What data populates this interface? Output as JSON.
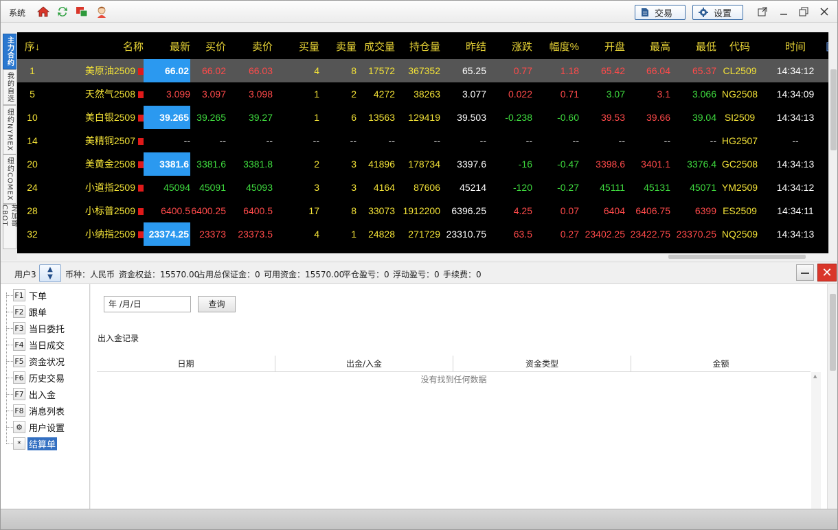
{
  "titlebar": {
    "menu_label": "系统",
    "trade_label": "交易",
    "settings_label": "设置"
  },
  "vtabs": [
    "主力合约",
    "我的自选",
    "纽约NYMEX",
    "纽约COMEX",
    "芝加哥CBOT"
  ],
  "quote": {
    "headers": [
      "序↓",
      "名称",
      "最新",
      "买价",
      "卖价",
      "买量",
      "卖量",
      "成交量",
      "持仓量",
      "昨结",
      "涨跌",
      "幅度%",
      "开盘",
      "最高",
      "最低",
      "代码",
      "时间"
    ],
    "rows": [
      {
        "seq": "1",
        "name": "美原油2509",
        "last": "66.02",
        "bid": "66.02",
        "ask": "66.03",
        "bidvol": "4",
        "askvol": "8",
        "vol": "17572",
        "oi": "367352",
        "prev": "65.25",
        "chg": "0.77",
        "pct": "1.18",
        "open": "65.42",
        "high": "66.04",
        "low": "65.37",
        "code": "CL2509",
        "time": "14:34:12"
      },
      {
        "seq": "5",
        "name": "天然气2508",
        "last": "3.099",
        "bid": "3.097",
        "ask": "3.098",
        "bidvol": "1",
        "askvol": "2",
        "vol": "4272",
        "oi": "38263",
        "prev": "3.077",
        "chg": "0.022",
        "pct": "0.71",
        "open": "3.07",
        "high": "3.1",
        "low": "3.066",
        "code": "NG2508",
        "time": "14:34:09"
      },
      {
        "seq": "10",
        "name": "美白银2509",
        "last": "39.265",
        "bid": "39.265",
        "ask": "39.27",
        "bidvol": "1",
        "askvol": "6",
        "vol": "13563",
        "oi": "129419",
        "prev": "39.503",
        "chg": "-0.238",
        "pct": "-0.60",
        "open": "39.53",
        "high": "39.66",
        "low": "39.04",
        "code": "SI2509",
        "time": "14:34:13"
      },
      {
        "seq": "14",
        "name": "美精铜2507",
        "last": "--",
        "bid": "--",
        "ask": "--",
        "bidvol": "--",
        "askvol": "--",
        "vol": "--",
        "oi": "--",
        "prev": "--",
        "chg": "--",
        "pct": "--",
        "open": "--",
        "high": "--",
        "low": "--",
        "code": "HG2507",
        "time": "--"
      },
      {
        "seq": "20",
        "name": "美黄金2508",
        "last": "3381.6",
        "bid": "3381.6",
        "ask": "3381.8",
        "bidvol": "2",
        "askvol": "3",
        "vol": "41896",
        "oi": "178734",
        "prev": "3397.6",
        "chg": "-16",
        "pct": "-0.47",
        "open": "3398.6",
        "high": "3401.1",
        "low": "3376.4",
        "code": "GC2508",
        "time": "14:34:13"
      },
      {
        "seq": "24",
        "name": "小道指2509",
        "last": "45094",
        "bid": "45091",
        "ask": "45093",
        "bidvol": "3",
        "askvol": "3",
        "vol": "4164",
        "oi": "87606",
        "prev": "45214",
        "chg": "-120",
        "pct": "-0.27",
        "open": "45111",
        "high": "45131",
        "low": "45071",
        "code": "YM2509",
        "time": "14:34:12"
      },
      {
        "seq": "28",
        "name": "小标普2509",
        "last": "6400.5",
        "bid": "6400.25",
        "ask": "6400.5",
        "bidvol": "17",
        "askvol": "8",
        "vol": "33073",
        "oi": "1912200",
        "prev": "6396.25",
        "chg": "4.25",
        "pct": "0.07",
        "open": "6404",
        "high": "6406.75",
        "low": "6399",
        "code": "ES2509",
        "time": "14:34:11"
      },
      {
        "seq": "32",
        "name": "小纳指2509",
        "last": "23374.25",
        "bid": "23373",
        "ask": "23373.5",
        "bidvol": "4",
        "askvol": "1",
        "vol": "24828",
        "oi": "271729",
        "prev": "23310.75",
        "chg": "63.5",
        "pct": "0.27",
        "open": "23402.25",
        "high": "23422.75",
        "low": "23370.25",
        "code": "NQ2509",
        "time": "14:34:13"
      }
    ]
  },
  "account": {
    "user": "用户3",
    "currency": "币种：人民币",
    "equity": "资金权益：15570.00",
    "margin": "占用总保证金：0",
    "available": "可用资金：15570.00",
    "close_pl": "平仓盈亏：0",
    "float_pl": "浮动盈亏：0",
    "fee": "手续费：0"
  },
  "tree": [
    {
      "key": "F1",
      "label": "下单"
    },
    {
      "key": "F2",
      "label": "跟单"
    },
    {
      "key": "F3",
      "label": "当日委托"
    },
    {
      "key": "F4",
      "label": "当日成交"
    },
    {
      "key": "F5",
      "label": "资金状况"
    },
    {
      "key": "F6",
      "label": "历史交易"
    },
    {
      "key": "F7",
      "label": "出入金"
    },
    {
      "key": "F8",
      "label": "消息列表"
    },
    {
      "key": "⚙",
      "label": "用户设置"
    },
    {
      "key": "*",
      "label": "结算单"
    }
  ],
  "content": {
    "date_value": "年 /月/日",
    "query_label": "查询",
    "section_title": "出入金记录",
    "columns": [
      "日期",
      "出金/入金",
      "资金类型",
      "金额"
    ],
    "empty_message": "没有找到任何数据"
  }
}
